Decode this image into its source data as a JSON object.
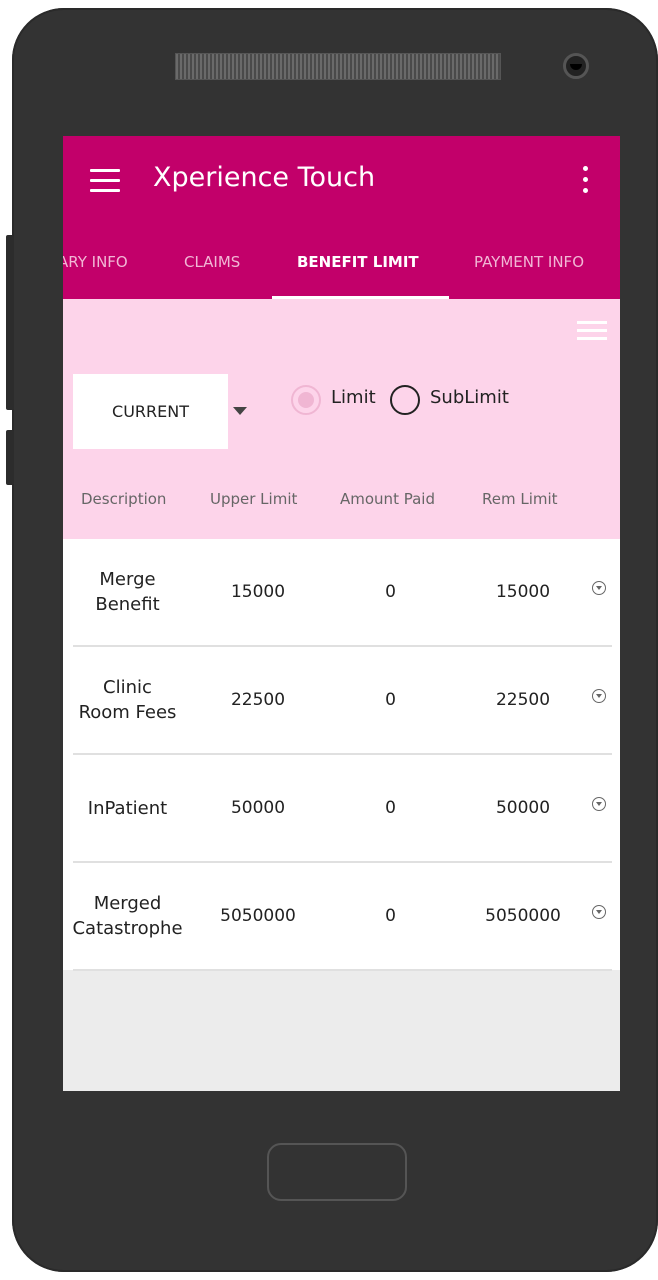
{
  "app": {
    "title": "Xperience Touch"
  },
  "tabs": [
    {
      "label": "ARY INFO",
      "active": false
    },
    {
      "label": "CLAIMS",
      "active": false
    },
    {
      "label": "BENEFIT LIMIT",
      "active": true
    },
    {
      "label": "PAYMENT INFO",
      "active": false
    }
  ],
  "filter": {
    "period_value": "CURRENT",
    "radio_limit_label": "Limit",
    "radio_sublimit_label": "SubLimit",
    "selected": "Limit"
  },
  "table": {
    "headers": [
      "Description",
      "Upper Limit",
      "Amount Paid",
      "Rem Limit"
    ],
    "rows": [
      {
        "description": "Merge Benefit",
        "upper_limit": "15000",
        "amount_paid": "0",
        "rem_limit": "15000"
      },
      {
        "description": "Clinic Room Fees",
        "upper_limit": "22500",
        "amount_paid": "0",
        "rem_limit": "22500"
      },
      {
        "description": "InPatient",
        "upper_limit": "50000",
        "amount_paid": "0",
        "rem_limit": "50000"
      },
      {
        "description": "Merged Catastrophe",
        "upper_limit": "5050000",
        "amount_paid": "0",
        "rem_limit": "5050000"
      }
    ]
  },
  "colors": {
    "appbar": "#c2006a",
    "filter_background": "#fdd4ea",
    "phone_body": "#333333"
  }
}
